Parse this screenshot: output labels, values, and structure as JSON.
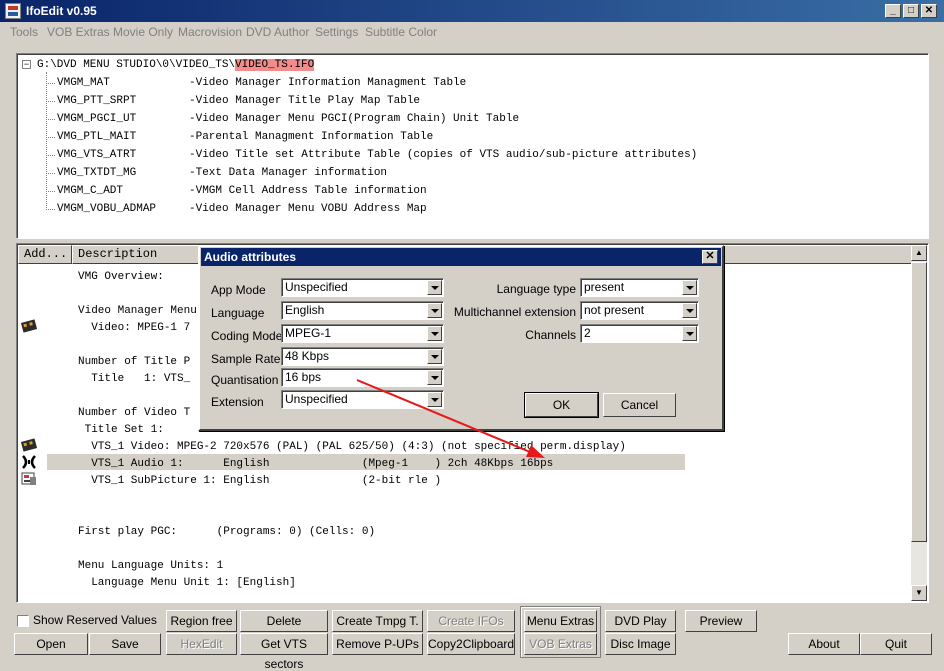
{
  "window": {
    "title": "IfoEdit v0.95"
  },
  "menu": [
    "Tools",
    "VOB Extras",
    "Movie Only",
    "Macrovision",
    "DVD Author",
    "Settings",
    "Subtitle Color"
  ],
  "tree": {
    "root_prefix": "G:\\DVD MENU STUDIO\\0\\VIDEO_TS\\",
    "root_file": "VIDEO_TS.IFO",
    "items": [
      {
        "name": "VMGM_MAT",
        "desc": "-Video Manager Information Managment Table"
      },
      {
        "name": "VMG_PTT_SRPT",
        "desc": "-Video Manager Title Play Map Table"
      },
      {
        "name": "VMGM_PGCI_UT",
        "desc": "-Video Manager Menu PGCI(Program Chain) Unit Table"
      },
      {
        "name": "VMG_PTL_MAIT",
        "desc": "-Parental Managment Information Table"
      },
      {
        "name": "VMG_VTS_ATRT",
        "desc": "-Video Title set Attribute Table (copies of VTS audio/sub-picture attributes)"
      },
      {
        "name": "VMG_TXTDT_MG",
        "desc": "-Text Data Manager information"
      },
      {
        "name": "VMGM_C_ADT",
        "desc": "-VMGM Cell Address Table information"
      },
      {
        "name": "VMGM_VOBU_ADMAP",
        "desc": "-Video Manager Menu VOBU Address Map"
      }
    ]
  },
  "list": {
    "headers": [
      "Add...",
      "Description"
    ],
    "lines": [
      "VMG Overview:",
      "",
      "Video Manager Menu",
      "  Video: MPEG-1 7",
      "",
      "Number of Title P",
      "  Title   1: VTS_",
      "",
      "Number of Video T",
      " Title Set 1:",
      "  VTS_1 Video: MPEG-2 720x576 (PAL) (PAL 625/50) (4:3) (not specified perm.display)",
      "  VTS_1 Audio 1:      English              (Mpeg-1    ) 2ch 48Kbps 16bps",
      "  VTS_1 SubPicture 1: English              (2-bit rle )",
      "",
      "",
      "First play PGC:      (Programs: 0) (Cells: 0)",
      "",
      "Menu Language Units: 1",
      "  Language Menu Unit 1: [English]"
    ]
  },
  "dialog": {
    "title": "Audio attributes",
    "left_fields": [
      {
        "label": "App Mode",
        "value": "Unspecified"
      },
      {
        "label": "Language",
        "value": "English"
      },
      {
        "label": "Coding Mode",
        "value": "MPEG-1"
      },
      {
        "label": "Sample Rate",
        "value": "48 Kbps"
      },
      {
        "label": "Quantisation",
        "value": "16 bps"
      },
      {
        "label": "Extension",
        "value": "Unspecified"
      }
    ],
    "right_fields": [
      {
        "label": "Language type",
        "value": "present"
      },
      {
        "label": "Multichannel extension",
        "value": "not present"
      },
      {
        "label": "Channels",
        "value": "2"
      }
    ],
    "ok_label": "OK",
    "cancel_label": "Cancel"
  },
  "bottom": {
    "show_reserved": "Show Reserved Values",
    "open": "Open",
    "save": "Save",
    "region_free": "Region free",
    "hexedit": "HexEdit",
    "delete_playback": "Delete Playback",
    "get_vts_sectors": "Get VTS sectors",
    "create_tmpg": "Create Tmpg T.",
    "remove_pups": "Remove P-UPs",
    "create_ifos": "Create IFOs",
    "copy2clipboard": "Copy2Clipboard",
    "menu_extras": "Menu Extras",
    "vob_extras": "VOB Extras",
    "dvd_play": "DVD Play",
    "disc_image": "Disc Image",
    "preview": "Preview",
    "about": "About",
    "quit": "Quit"
  },
  "colors": {
    "title_bar": "#0a246a",
    "path_highlight": "#f28c8c",
    "arrow": "#e8191a"
  }
}
